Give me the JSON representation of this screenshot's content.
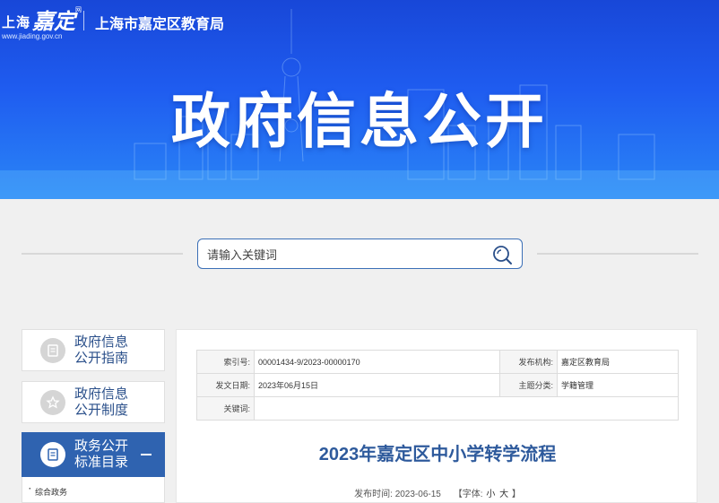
{
  "header": {
    "logo_city": "上海",
    "logo_script": "嘉定",
    "logo_net": "网",
    "logo_url": "www.jiading.gov.cn",
    "department": "上海市嘉定区教育局",
    "banner_title": "政府信息公开"
  },
  "search": {
    "placeholder": "请输入关键词"
  },
  "sidebar": {
    "items": [
      {
        "label_line1": "政府信息",
        "label_line2": "公开指南",
        "icon": "document-icon"
      },
      {
        "label_line1": "政府信息",
        "label_line2": "公开制度",
        "icon": "star-icon"
      },
      {
        "label_line1": "政务公开",
        "label_line2": "标准目录",
        "icon": "document-icon",
        "active": true
      }
    ],
    "sub_items": [
      "综合政务"
    ]
  },
  "meta": {
    "index_label": "索引号:",
    "index_value": "00001434-9/2023-00000170",
    "org_label": "发布机构:",
    "org_value": "嘉定区教育局",
    "date_label": "发文日期:",
    "date_value": "2023年06月15日",
    "category_label": "主题分类:",
    "category_value": "学籍管理",
    "keywords_label": "关键词:",
    "keywords_value": ""
  },
  "article": {
    "title": "2023年嘉定区中小学转学流程",
    "pub_prefix": "发布时间:",
    "pub_date": "2023-06-15",
    "font_label": "【字体:",
    "font_small": "小",
    "font_large": "大",
    "font_close": "】"
  },
  "colors": {
    "banner": "#1f5cf0",
    "accent": "#2f63b0",
    "title": "#2e5a9c"
  }
}
